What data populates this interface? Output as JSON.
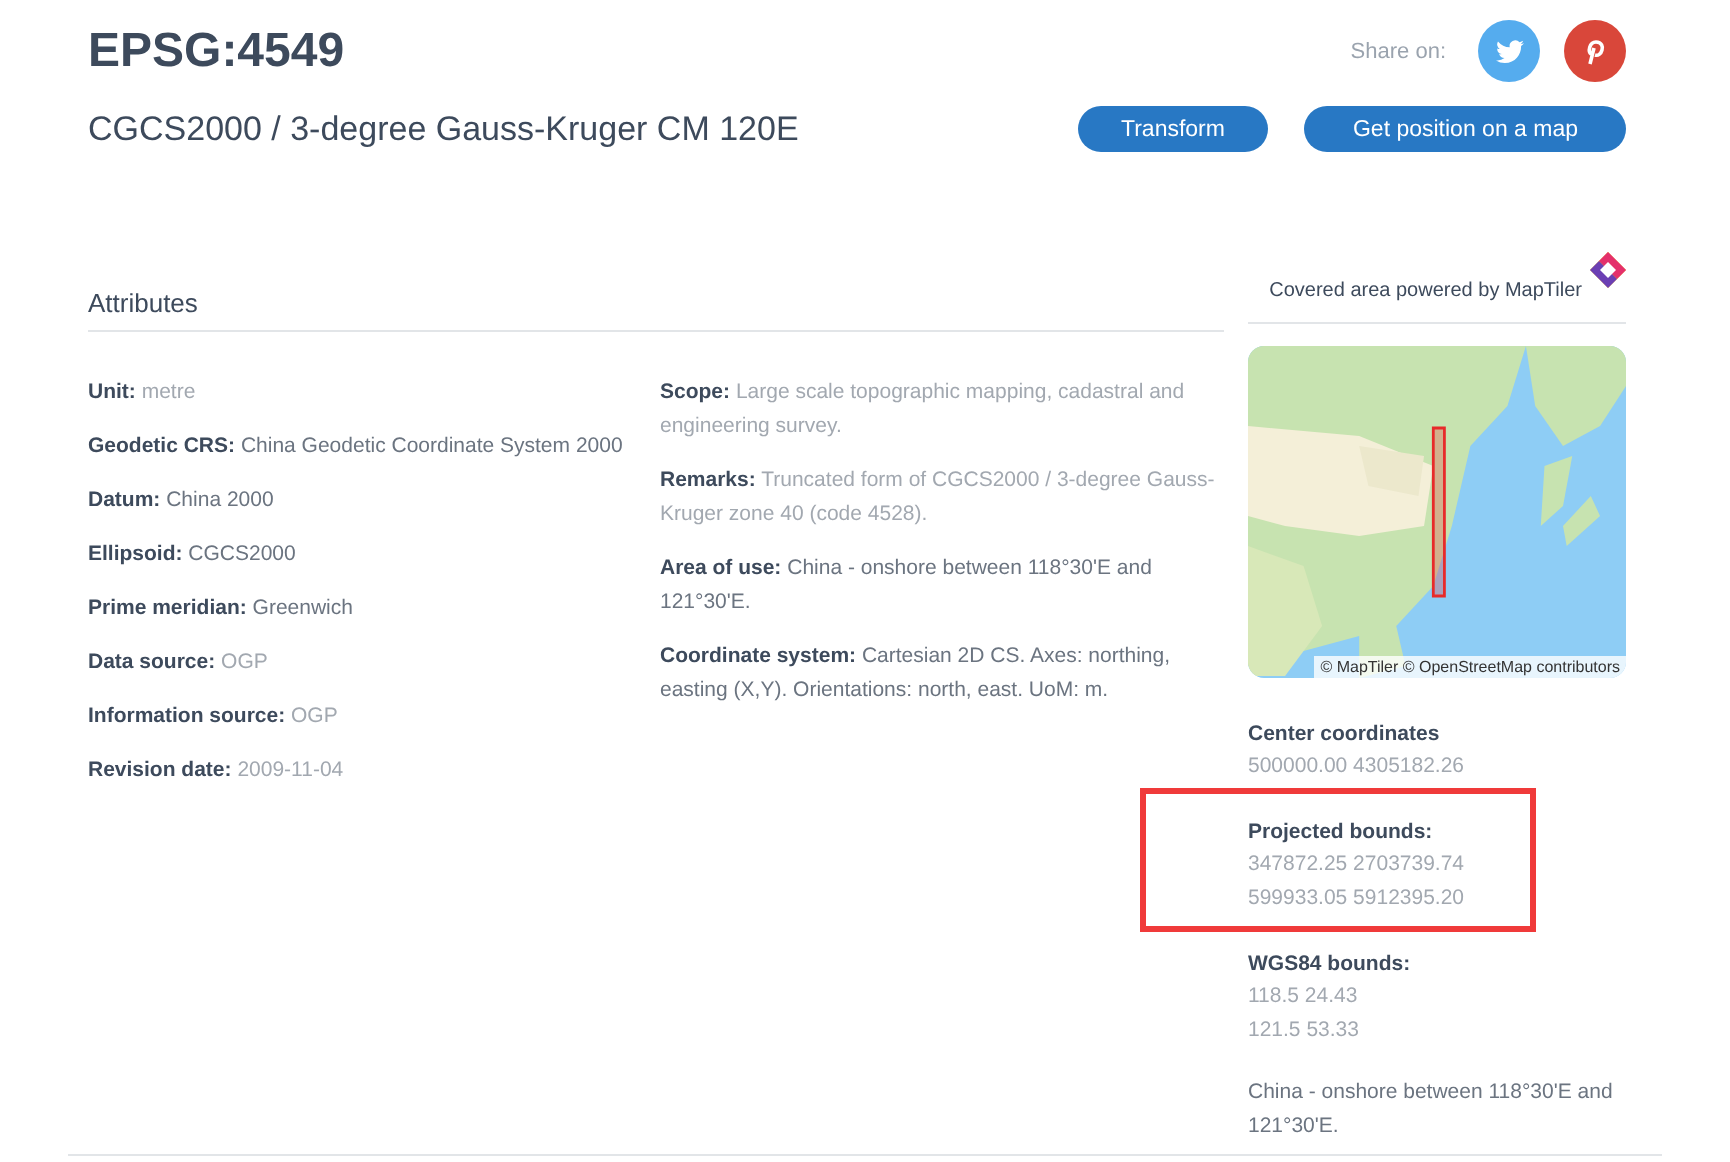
{
  "header": {
    "code": "EPSG:4549",
    "name": "CGCS2000 / 3-degree Gauss-Kruger CM 120E",
    "share_label": "Share on:",
    "share_buttons": [
      {
        "kind": "twitter"
      },
      {
        "kind": "pinterest"
      }
    ],
    "buttons": [
      "Transform",
      "Get position on a map"
    ]
  },
  "attributes": {
    "title": "Attributes",
    "left": [
      {
        "label": "Unit:",
        "value": "metre",
        "muted": true
      },
      {
        "label": "Geodetic CRS:",
        "value": "China Geodetic Coordinate System 2000",
        "muted": false
      },
      {
        "label": "Datum:",
        "value": "China 2000",
        "muted": false
      },
      {
        "label": "Ellipsoid:",
        "value": "CGCS2000",
        "muted": false
      },
      {
        "label": "Prime meridian:",
        "value": "Greenwich",
        "muted": false
      },
      {
        "label": "Data source:",
        "value": "OGP",
        "muted": true
      },
      {
        "label": "Information source:",
        "value": "OGP",
        "muted": true
      },
      {
        "label": "Revision date:",
        "value": "2009-11-04",
        "muted": true
      }
    ],
    "right": [
      {
        "label": "Scope:",
        "value": "Large scale topographic mapping, cadastral and engineering survey.",
        "muted": true
      },
      {
        "label": "Remarks:",
        "value": "Truncated form of CGCS2000 / 3-degree Gauss-Kruger zone 40 (code 4528).",
        "muted": true
      },
      {
        "label": "Area of use:",
        "value": "China - onshore between 118°30'E and 121°30'E.",
        "muted": false
      },
      {
        "label": "Coordinate system:",
        "value": "Cartesian 2D CS. Axes: northing, easting (X,Y). Orientations: north, east. UoM: m.",
        "muted": false
      }
    ]
  },
  "side": {
    "powered_by": "Covered area powered by MapTiler",
    "map": {
      "kind": "picture",
      "attribution": "© MapTiler © OpenStreetMap contributors"
    },
    "sections": [
      {
        "title": "Center coordinates",
        "lines": [
          "500000.00 4305182.26"
        ],
        "highlighted": false
      },
      {
        "title": "Projected bounds:",
        "lines": [
          "347872.25 2703739.74",
          "599933.05 5912395.20"
        ],
        "highlighted": true
      },
      {
        "title": "WGS84 bounds:",
        "lines": [
          "118.5 24.43",
          "121.5 53.33"
        ],
        "highlighted": false
      }
    ],
    "area_text": "China - onshore between 118°30'E and 121°30'E."
  }
}
